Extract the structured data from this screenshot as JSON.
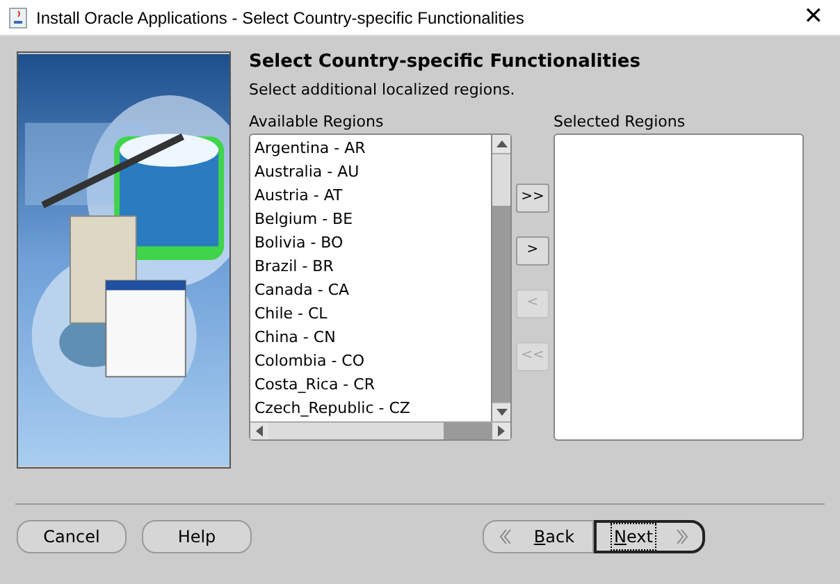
{
  "window": {
    "title": "Install Oracle Applications - Select Country-specific Functionalities",
    "close": "✕"
  },
  "heading": "Select Country-specific Functionalities",
  "instruction": "Select additional localized regions.",
  "available": {
    "label": "Available Regions",
    "items": [
      "Argentina - AR",
      "Australia - AU",
      "Austria - AT",
      "Belgium - BE",
      "Bolivia - BO",
      "Brazil - BR",
      "Canada - CA",
      "Chile - CL",
      "China - CN",
      "Colombia - CO",
      "Costa_Rica - CR",
      "Czech_Republic - CZ"
    ]
  },
  "move_buttons": [
    {
      "label": ">>",
      "disabled": false
    },
    {
      "label": ">",
      "disabled": false
    },
    {
      "label": "<",
      "disabled": true
    },
    {
      "label": "<<",
      "disabled": true
    }
  ],
  "selected": {
    "label": "Selected Regions"
  },
  "footer_left": [
    {
      "label": "Cancel",
      "mnemonic": false
    },
    {
      "label": "Help",
      "mnemonic": false
    }
  ],
  "nav": [
    {
      "kind": "back",
      "label": "Back",
      "mnemonic": true,
      "focused": false
    },
    {
      "kind": "next",
      "label": "Next",
      "mnemonic": true,
      "focused": true
    }
  ]
}
